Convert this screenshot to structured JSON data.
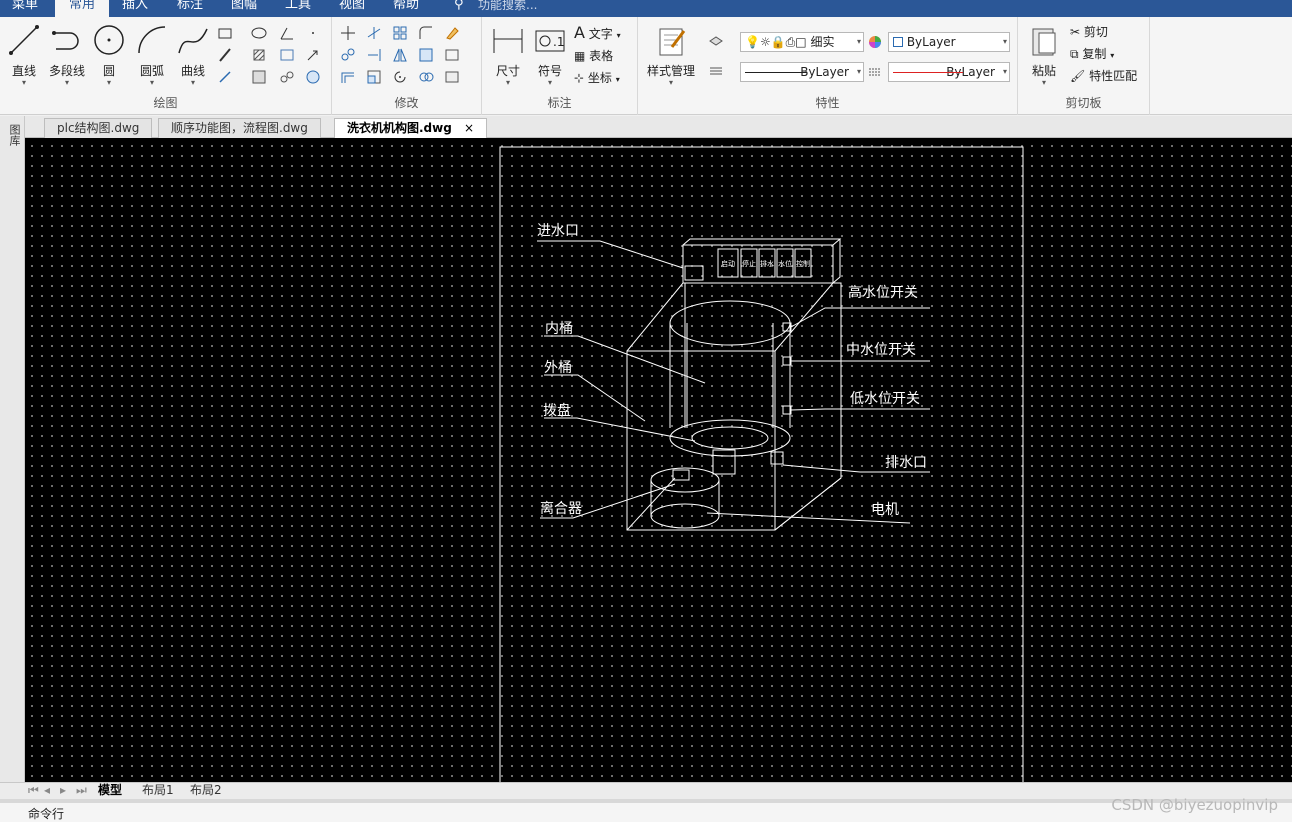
{
  "menu": {
    "tabs": [
      {
        "label": "菜单",
        "active": false
      },
      {
        "label": "常用",
        "active": true
      },
      {
        "label": "插入",
        "active": false
      },
      {
        "label": "标注",
        "active": false
      },
      {
        "label": "图幅",
        "active": false
      },
      {
        "label": "工具",
        "active": false
      },
      {
        "label": "视图",
        "active": false
      },
      {
        "label": "帮助",
        "active": false
      }
    ],
    "search_placeholder": "功能搜索..."
  },
  "ribbon": {
    "draw": {
      "title": "绘图",
      "line": "直线",
      "polyline": "多段线",
      "circle": "圆",
      "arc": "圆弧",
      "curve": "曲线"
    },
    "modify": {
      "title": "修改"
    },
    "annotate": {
      "title": "标注",
      "dimension": "尺寸",
      "symbol": "符号",
      "text": "文字",
      "table": "表格",
      "coordinate": "坐标"
    },
    "properties": {
      "title": "特性",
      "style_manager": "样式管理",
      "layer_name": "细实",
      "color_combo": "ByLayer",
      "linetype_combo": "ByLayer",
      "lineweight_combo": "ByLayer"
    },
    "clipboard": {
      "title": "剪切板",
      "paste": "粘贴",
      "cut": "剪切",
      "copy": "复制",
      "match_props": "特性匹配"
    }
  },
  "doc_tabs": [
    {
      "label": "plc结构图.dwg",
      "active": false
    },
    {
      "label": "顺序功能图，流程图.dwg",
      "active": false
    },
    {
      "label": "洗衣机机构图.dwg",
      "active": true
    }
  ],
  "left_tool_label": "图库",
  "drawing": {
    "labels": {
      "water_inlet": "进水口",
      "high_level_switch": "高水位开关",
      "mid_level_switch": "中水位开关",
      "low_level_switch": "低水位开关",
      "inner_tub": "内桶",
      "outer_tub": "外桶",
      "impeller": "拨盘",
      "drain_outlet": "排水口",
      "clutch": "离合器",
      "motor": "电机"
    },
    "panel_buttons": [
      "启动",
      "停止",
      "排水",
      "水位",
      "控制"
    ]
  },
  "layout_tabs": [
    {
      "label": "模型",
      "active": true
    },
    {
      "label": "布局1",
      "active": false
    },
    {
      "label": "布局2",
      "active": false
    }
  ],
  "command_line": "命令行",
  "watermark": "CSDN @biyezuopinvip",
  "colors": {
    "menubar": "#2b5797",
    "canvas": "#000000",
    "drawing_lines": "#ffffff"
  }
}
